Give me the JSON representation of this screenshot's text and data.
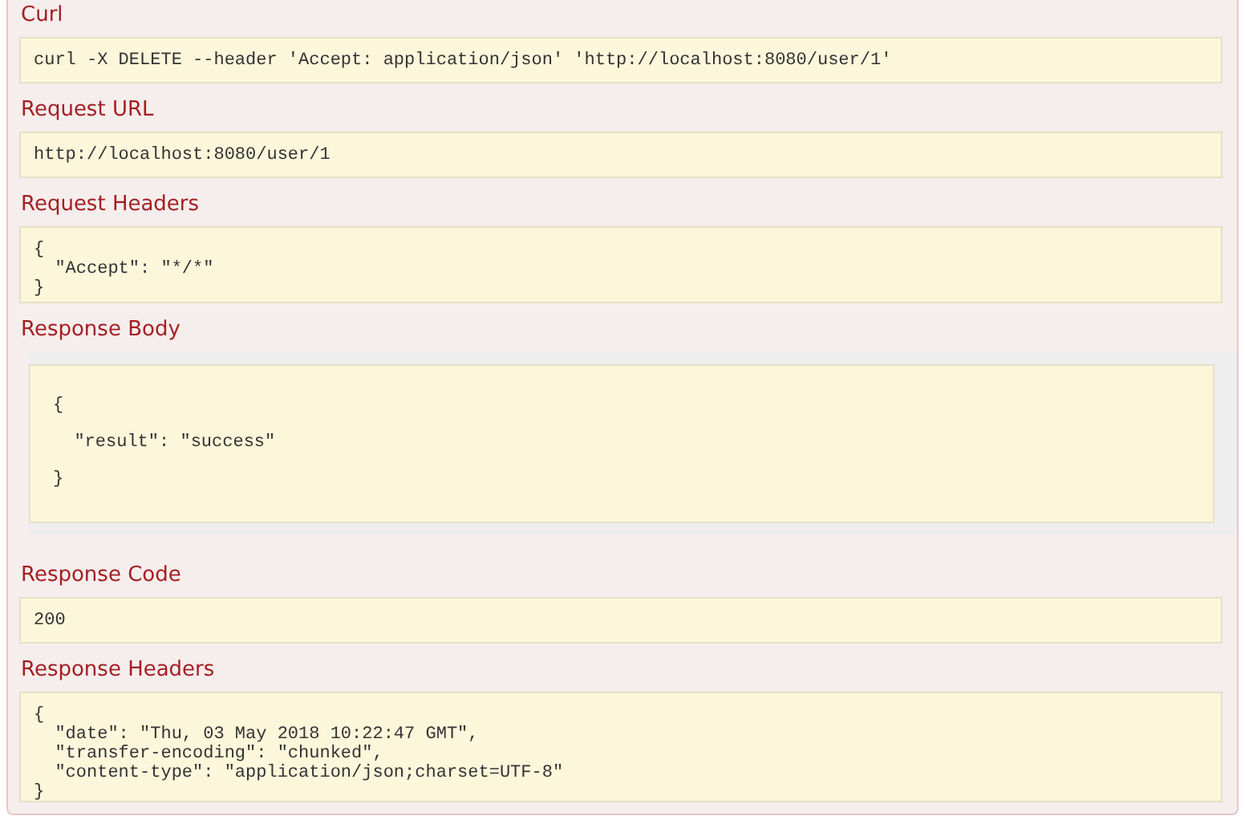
{
  "sections": [
    {
      "title": "Curl",
      "kind": "code",
      "text": "curl -X DELETE --header 'Accept: application/json' 'http://localhost:8080/user/1'"
    },
    {
      "title": "Request URL",
      "kind": "code",
      "text": "http://localhost:8080/user/1"
    },
    {
      "title": "Request Headers",
      "kind": "code",
      "text": "{\n  \"Accept\": \"*/*\"\n}"
    },
    {
      "title": "Response Body",
      "kind": "body",
      "text": "{\n  \"result\": \"success\"\n}"
    },
    {
      "title": "Response Code",
      "kind": "code",
      "text": "200"
    },
    {
      "title": "Response Headers",
      "kind": "code",
      "text": "{\n  \"date\": \"Thu, 03 May 2018 10:22:47 GMT\",\n  \"transfer-encoding\": \"chunked\",\n  \"content-type\": \"application/json;charset=UTF-8\"\n}"
    }
  ]
}
